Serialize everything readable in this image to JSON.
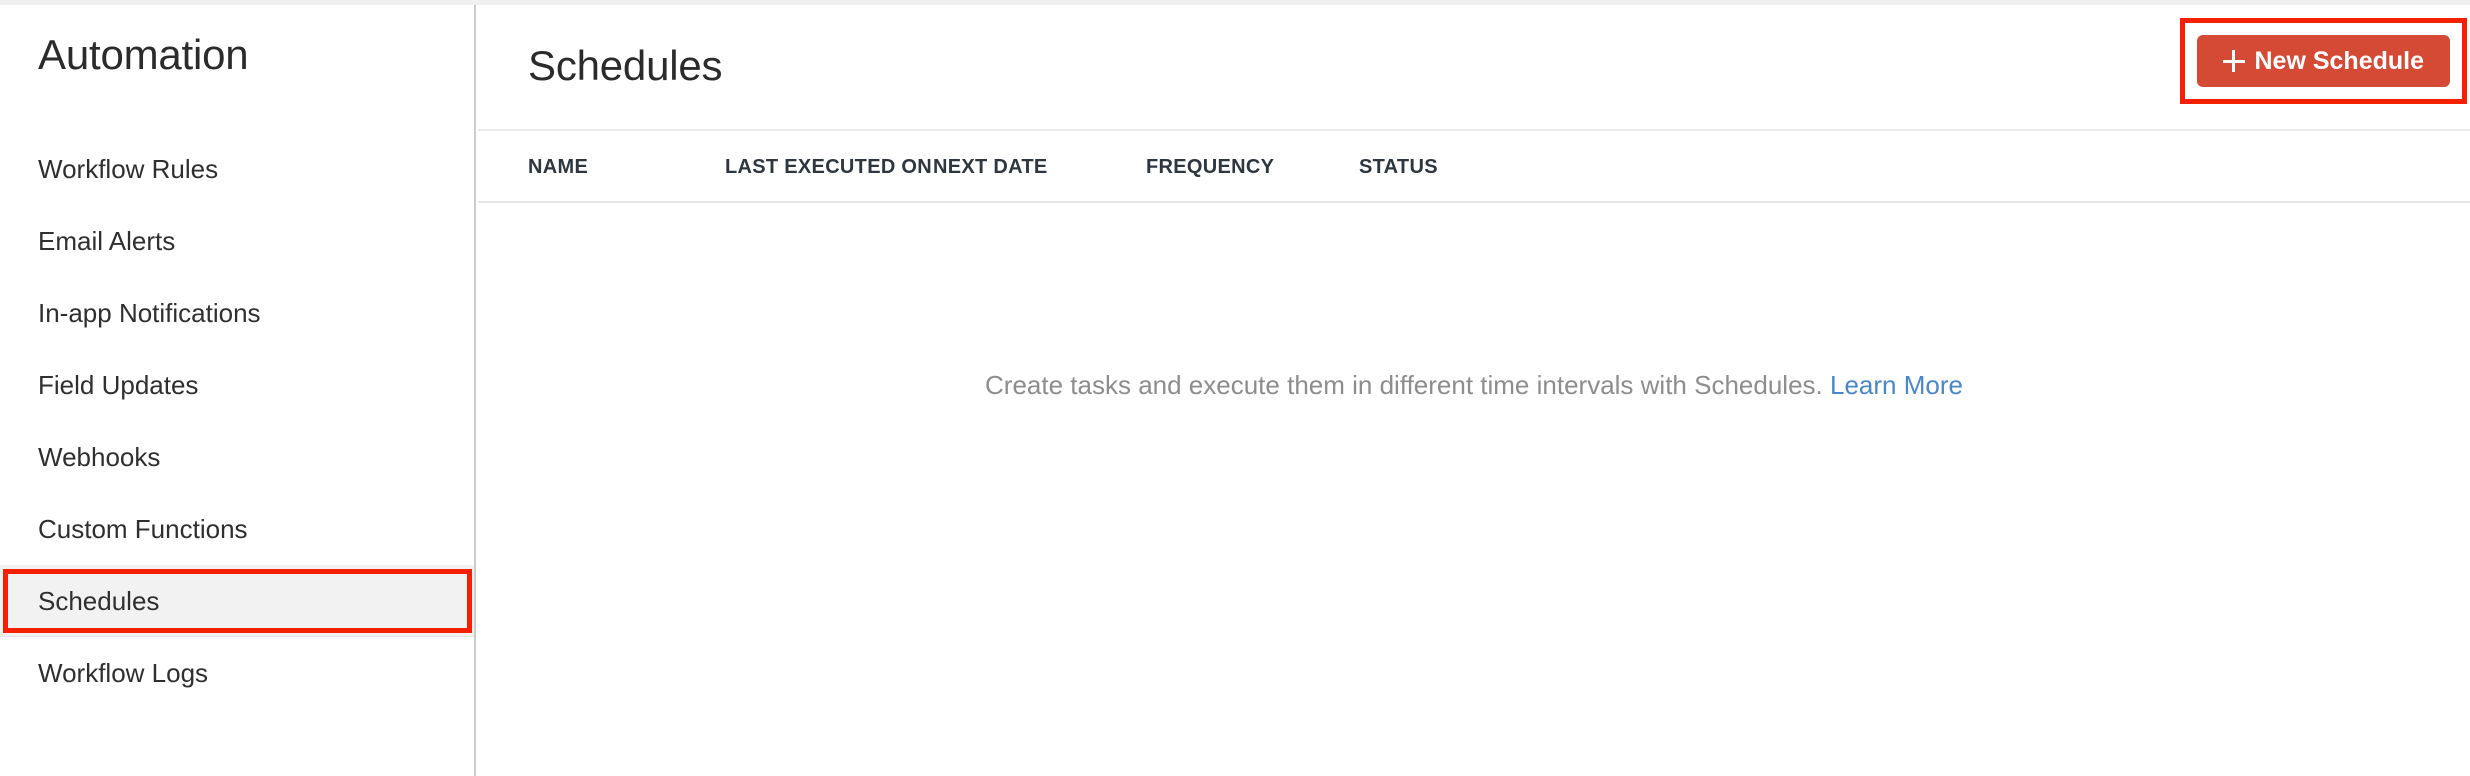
{
  "sidebar": {
    "title": "Automation",
    "items": [
      {
        "label": "Workflow Rules",
        "active": false,
        "highlighted": false
      },
      {
        "label": "Email Alerts",
        "active": false,
        "highlighted": false
      },
      {
        "label": "In-app Notifications",
        "active": false,
        "highlighted": false
      },
      {
        "label": "Field Updates",
        "active": false,
        "highlighted": false
      },
      {
        "label": "Webhooks",
        "active": false,
        "highlighted": false
      },
      {
        "label": "Custom Functions",
        "active": false,
        "highlighted": false
      },
      {
        "label": "Schedules",
        "active": true,
        "highlighted": true
      },
      {
        "label": "Workflow Logs",
        "active": false,
        "highlighted": false
      }
    ]
  },
  "header": {
    "title": "Schedules",
    "new_button": {
      "label": "New Schedule",
      "icon": "plus-icon",
      "highlighted": true
    }
  },
  "table": {
    "columns": [
      "NAME",
      "LAST EXECUTED ON",
      "NEXT DATE",
      "FREQUENCY",
      "STATUS"
    ],
    "rows": []
  },
  "empty_state": {
    "message": "Create tasks and execute them in different time intervals with Schedules.",
    "link_label": "Learn More"
  },
  "colors": {
    "accent_button": "#d44a34",
    "highlight_box": "#f42000",
    "link": "#4a87c9",
    "active_row_bg": "#f2f2f2",
    "divider": "#e6e6e6",
    "sidebar_border": "#cccccc",
    "muted_text": "#8d8d8d"
  }
}
